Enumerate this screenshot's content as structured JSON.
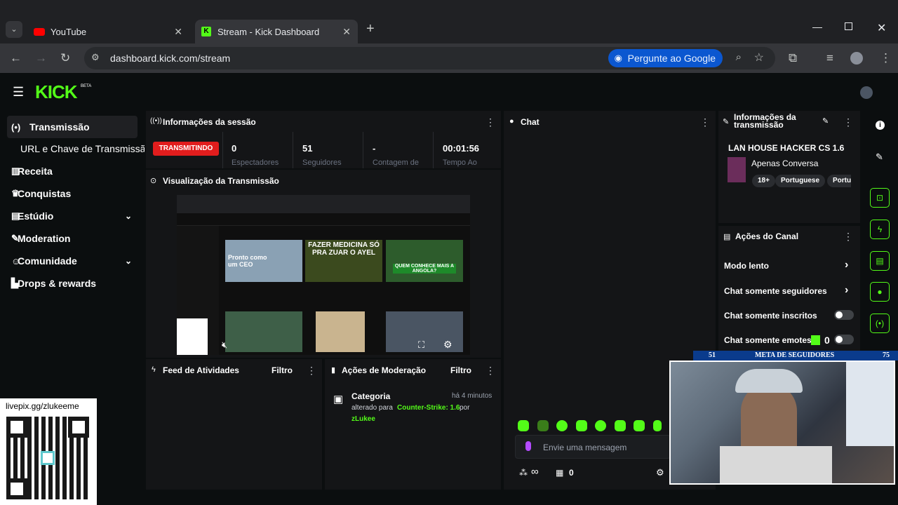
{
  "browser": {
    "tabs": [
      {
        "label": "YouTube",
        "icon": "youtube-icon"
      },
      {
        "label": "Stream - Kick Dashboard",
        "icon": "kick-icon"
      }
    ],
    "url": "dashboard.kick.com/stream",
    "ask_google": "Pergunte ao Google"
  },
  "kick": {
    "logo": "KICK",
    "beta": "BETA",
    "brand_color": "#53fc18"
  },
  "sidebar": {
    "items": [
      {
        "label": "Transmissão",
        "icon": "broadcast-icon"
      },
      {
        "label": "URL e Chave de Transmissão"
      },
      {
        "label": "Receita",
        "icon": "chart-icon"
      },
      {
        "label": "Conquistas",
        "icon": "trophy-icon"
      },
      {
        "label": "Estúdio",
        "icon": "studio-icon"
      },
      {
        "label": "Moderation",
        "icon": "wrench-icon"
      },
      {
        "label": "Comunidade",
        "icon": "people-icon"
      },
      {
        "label": "Drops & rewards",
        "icon": "drops-icon"
      }
    ]
  },
  "session": {
    "title": "Informações da sessão",
    "live_badge": "TRANSMITINDO",
    "stats": [
      {
        "value": "0",
        "label": "Espectadores"
      },
      {
        "value": "51",
        "label": "Seguidores"
      },
      {
        "value": "-",
        "label": "Contagem de"
      },
      {
        "value": "00:01:56",
        "label": "Tempo Ao"
      }
    ]
  },
  "preview": {
    "title": "Visualização da Transmissão",
    "thumb_texts": [
      "Pronto como um CEO",
      "FAZER MEDICINA SÓ PRA ZUAR O AYEL",
      "QUEM CONHECE MAIS A ANGOLA?"
    ]
  },
  "activity": {
    "title": "Feed de Atividades",
    "filter": "Filtro"
  },
  "mod_actions": {
    "title": "Ações de Moderação",
    "filter": "Filtro",
    "entry": {
      "title": "Categoria",
      "time": "há 4 minutos",
      "text_prefix": "alterado para",
      "category": "Counter-Strike: 1.6",
      "by": "por",
      "user": "zLukee"
    }
  },
  "chat": {
    "title": "Chat",
    "placeholder": "Envie uma mensagem",
    "infinity": "∞",
    "points": "0"
  },
  "stream_info": {
    "title": "Informações da transmissão",
    "stream_title": "LAN HOUSE HACKER CS 1.6",
    "category": "Apenas Conversa",
    "tags": [
      "18+",
      "Portuguese",
      "Portug"
    ]
  },
  "channel_actions": {
    "title": "Ações do Canal",
    "items": [
      {
        "label": "Modo lento"
      },
      {
        "label": "Chat somente seguidores"
      },
      {
        "label": "Chat somente inscritos"
      },
      {
        "label": "Chat somente emotes"
      }
    ],
    "emote_count": "0"
  },
  "overlay": {
    "livepix": "livepix.gg/zlukeeme",
    "meta_title": "META DE SEGUIDORES",
    "meta_current": "51",
    "meta_target": "75"
  }
}
